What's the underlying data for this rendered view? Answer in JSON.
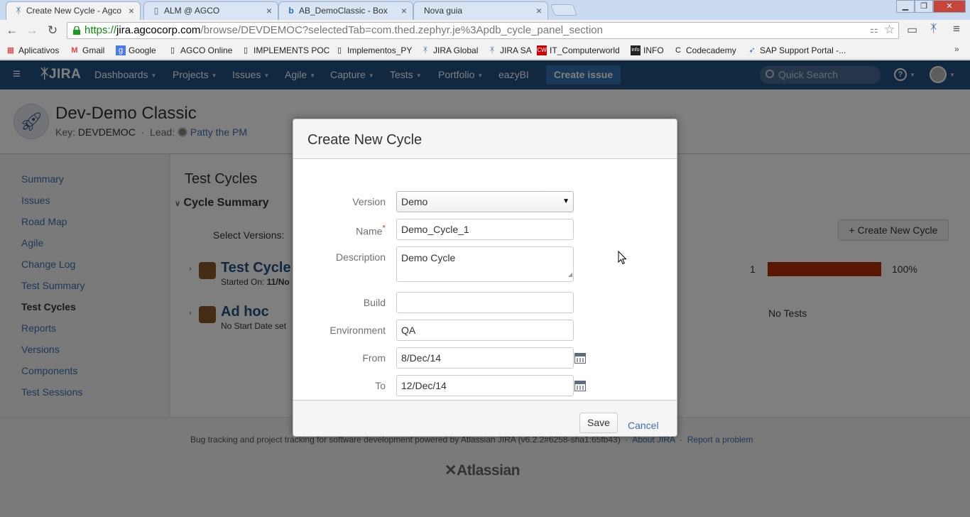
{
  "browser": {
    "tabs": [
      {
        "title": "Create New Cycle - Agco",
        "icon": "jira-icon"
      },
      {
        "title": "ALM @ AGCO",
        "icon": "page-icon"
      },
      {
        "title": "AB_DemoClassic - Box",
        "icon": "box-icon"
      },
      {
        "title": "Nova guia",
        "icon": ""
      }
    ],
    "url": {
      "protocol": "https://",
      "host": "jira.agcocorp.com",
      "path": "/browse/DEVDEMOC?selectedTab=com.thed.zephyr.je%3Apdb_cycle_panel_section"
    },
    "bookmarks": [
      "Aplicativos",
      "Gmail",
      "Google",
      "AGCO Online",
      "IMPLEMENTS POC",
      "Implementos_PY",
      "JIRA Global",
      "JIRA SA",
      "IT_Computerworld",
      "INFO",
      "Codecademy",
      "SAP Support Portal -..."
    ]
  },
  "jira": {
    "nav": [
      "Dashboards",
      "Projects",
      "Issues",
      "Agile",
      "Capture",
      "Tests",
      "Portfolio",
      "eazyBI"
    ],
    "create_issue": "Create issue",
    "quick_search_placeholder": "Quick Search",
    "project": {
      "name": "Dev-Demo Classic",
      "key_label": "Key:",
      "key": "DEVDEMOC",
      "lead_label": "Lead:",
      "lead": "Patty the PM"
    },
    "sidebar": [
      "Summary",
      "Issues",
      "Road Map",
      "Agile",
      "Change Log",
      "Test Summary",
      "Test Cycles",
      "Reports",
      "Versions",
      "Components",
      "Test Sessions"
    ],
    "sidebar_active": "Test Cycles",
    "content": {
      "title": "Test Cycles",
      "section": "Cycle Summary",
      "select_versions": "Select Versions:",
      "create_button": "Create New Cycle",
      "cycles": [
        {
          "name": "Test Cycle",
          "sub_label": "Started On:",
          "sub_value": "11/No",
          "count": "1",
          "percent": "100%",
          "progress": 1.0
        },
        {
          "name": "Ad hoc",
          "sub_label": "No Start Date set",
          "sub_value": "",
          "status": "No Tests"
        }
      ]
    },
    "footer": {
      "text": "Bug tracking and project tracking for software development powered by Atlassian JIRA (v6.2.2#6258-sha1:65fb43)",
      "about": "About JIRA",
      "report": "Report a problem",
      "logo": "Atlassian"
    }
  },
  "dialog": {
    "title": "Create New Cycle",
    "fields": {
      "version": {
        "label": "Version",
        "value": "Demo"
      },
      "name": {
        "label": "Name",
        "value": "Demo_Cycle_1",
        "required": "*"
      },
      "description": {
        "label": "Description",
        "value": "Demo Cycle"
      },
      "build": {
        "label": "Build",
        "value": ""
      },
      "environment": {
        "label": "Environment",
        "value": "QA"
      },
      "from": {
        "label": "From",
        "value": "8/Dec/14"
      },
      "to": {
        "label": "To",
        "value": "12/Dec/14"
      }
    },
    "save": "Save",
    "cancel": "Cancel"
  },
  "colors": {
    "jira_header": "#205081",
    "link": "#3b73af",
    "progress": "#b22d00",
    "required": "#d04437"
  }
}
